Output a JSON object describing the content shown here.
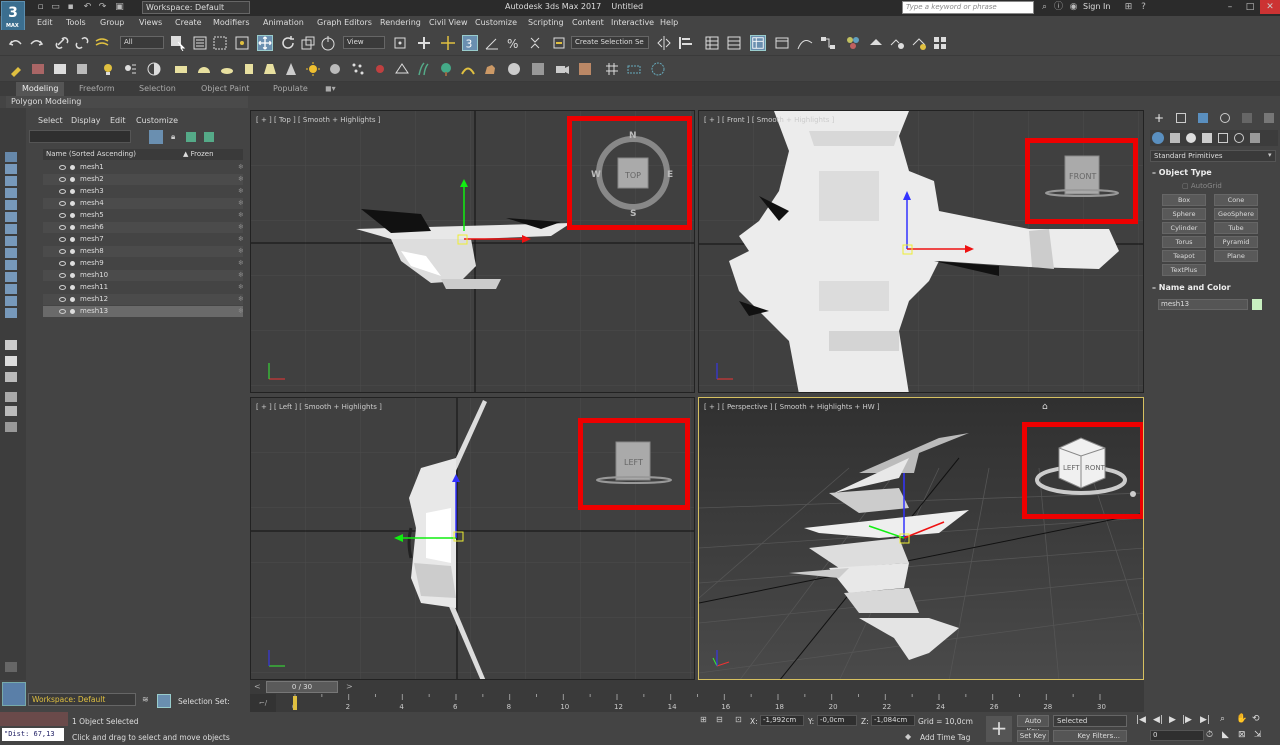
{
  "window": {
    "logo_text": "3",
    "logo_sub": "MAX",
    "workspace": "Workspace: Default",
    "title_app": "Autodesk 3ds Max 2017",
    "title_doc": "Untitled",
    "search_placeholder": "Type a keyword or phrase",
    "sign_in": "Sign In"
  },
  "menu": [
    "Edit",
    "Tools",
    "Group",
    "Views",
    "Create",
    "Modifiers",
    "Animation",
    "Graph Editors",
    "Rendering",
    "Civil View",
    "Customize",
    "Scripting",
    "Content",
    "Interactive",
    "Help"
  ],
  "toolbar": {
    "selection_filter": "All",
    "ref_coord": "View",
    "named_selection": "Create Selection Se"
  },
  "ribbon": {
    "tabs": [
      "Modeling",
      "Freeform",
      "Selection",
      "Object Paint",
      "Populate"
    ],
    "active_tab": "Modeling",
    "sub_label": "Polygon Modeling"
  },
  "explorer": {
    "menu": [
      "Select",
      "Display",
      "Edit",
      "Customize"
    ],
    "col_name": "Name (Sorted Ascending)",
    "col_frozen": "▲ Frozen",
    "items": [
      "mesh1",
      "mesh2",
      "mesh3",
      "mesh4",
      "mesh5",
      "mesh6",
      "mesh7",
      "mesh8",
      "mesh9",
      "mesh10",
      "mesh11",
      "mesh12",
      "mesh13"
    ],
    "selected": "mesh13"
  },
  "viewports": {
    "top": "[ + ] [ Top ] [ Smooth + Highlights ]",
    "front": "[ + ] [ Front ] [ Smooth + Highlights ]",
    "left": "[ + ] [ Left ] [ Smooth + Highlights ]",
    "perspective": "[ + ] [ Perspective ] [ Smooth + Highlights + HW ]",
    "compass_n": "N",
    "compass_e": "E",
    "compass_s": "S",
    "compass_w": "W",
    "cube_top": "TOP",
    "cube_front": "FRONT",
    "cube_left": "LEFT",
    "cube_persp_left": "LEFT",
    "cube_persp_front": "RONT"
  },
  "command_panel": {
    "category": "Standard Primitives",
    "object_type_title": "Object Type",
    "autogrid": "AutoGrid",
    "primitives": [
      "Box",
      "Cone",
      "Sphere",
      "GeoSphere",
      "Cylinder",
      "Tube",
      "Torus",
      "Pyramid",
      "Teapot",
      "Plane",
      "TextPlus"
    ],
    "name_color_title": "Name and Color",
    "object_name": "mesh13",
    "object_color": "#c8f0c0"
  },
  "timeline": {
    "frame_display": "0 / 30",
    "ticks": [
      "0",
      "2",
      "4",
      "6",
      "8",
      "10",
      "12",
      "14",
      "16",
      "18",
      "20",
      "22",
      "24",
      "26",
      "28",
      "30"
    ]
  },
  "status": {
    "workspace": "Workspace: Default",
    "selection_set": "Selection Set:",
    "maxscript": "\"Dist: 67,13",
    "objects_selected": "1 Object Selected",
    "prompt": "Click and drag to select and move objects",
    "x_label": "X:",
    "x_val": "-1,992cm",
    "y_label": "Y:",
    "y_val": "-0,0cm",
    "z_label": "Z:",
    "z_val": "-1,084cm",
    "grid": "Grid = 10,0cm",
    "add_time_tag": "Add Time Tag",
    "auto_key": "Auto Key",
    "set_key": "Set Key",
    "key_mode": "Selected",
    "key_filters": "Key Filters...",
    "frame_value": "0"
  },
  "colors": {
    "accent": "#e00000",
    "viewport_bg": "#3f3f3f",
    "active_viewport_border": "#d6c060"
  }
}
